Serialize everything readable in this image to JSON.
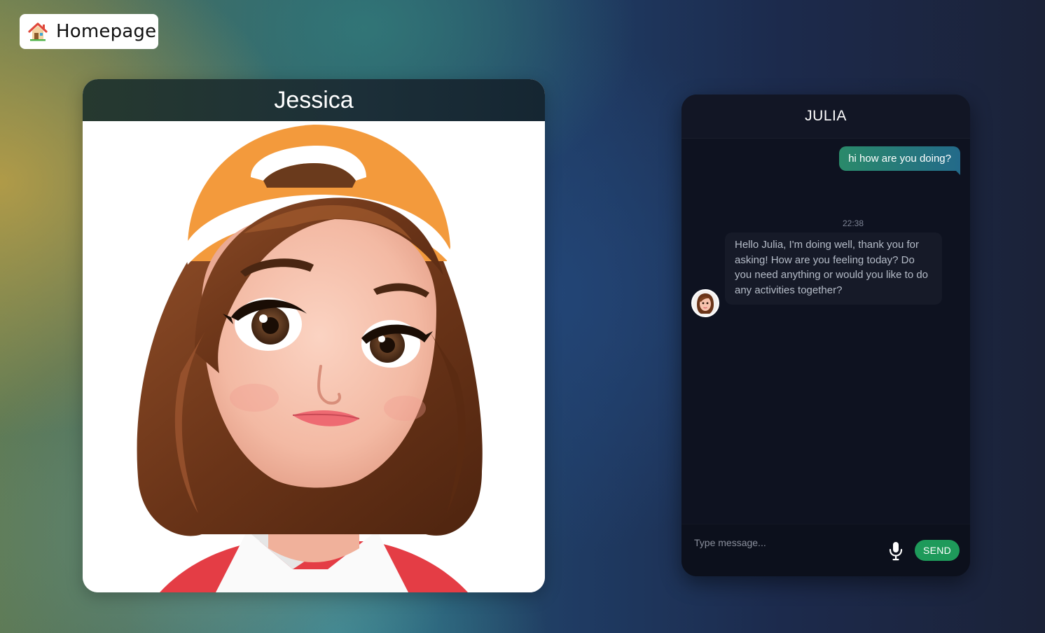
{
  "nav": {
    "home_label": "Homepage",
    "home_icon": "house-icon"
  },
  "character": {
    "name": "Jessica",
    "portrait": "cartoon-girl-portrait"
  },
  "chat": {
    "title": "JULIA",
    "messages": [
      {
        "sender": "user",
        "text": "hi how are you doing?",
        "time": "22:38"
      },
      {
        "sender": "bot",
        "text": "Hello Julia, I'm doing well, thank you for asking! How are you feeling today? Do you need anything or would you like to do any activities together?"
      }
    ],
    "input_placeholder": "Type message...",
    "send_label": "SEND",
    "mic_icon": "microphone-icon"
  },
  "colors": {
    "send_button": "#1e9a5a",
    "user_bubble": "#2a8a6a",
    "chat_panel": "#0e1220"
  }
}
